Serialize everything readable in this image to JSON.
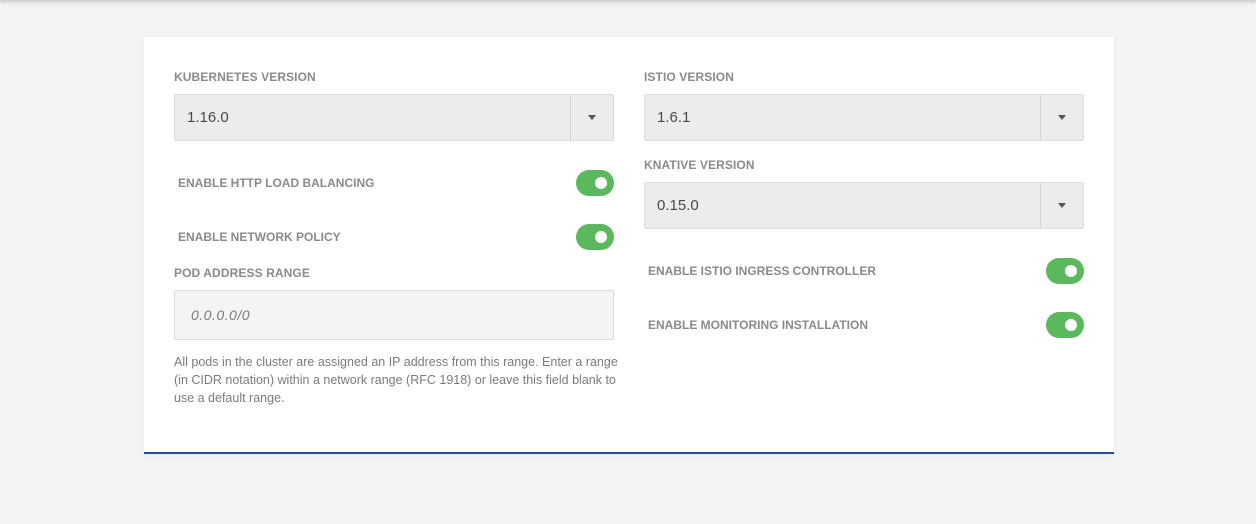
{
  "left": {
    "kubernetes_version": {
      "label": "KUBERNETES VERSION",
      "value": "1.16.0"
    },
    "http_load_balancing": {
      "label": "ENABLE HTTP LOAD BALANCING",
      "enabled": true
    },
    "network_policy": {
      "label": "ENABLE NETWORK POLICY",
      "enabled": true
    },
    "pod_address_range": {
      "label": "POD ADDRESS RANGE",
      "placeholder": "0.0.0.0/0",
      "help": "All pods in the cluster are assigned an IP address from this range. Enter a range (in CIDR notation) within a network range (RFC 1918) or leave this field blank to use a default range."
    }
  },
  "right": {
    "istio_version": {
      "label": "ISTIO VERSION",
      "value": "1.6.1"
    },
    "knative_version": {
      "label": "KNATIVE VERSION",
      "value": "0.15.0"
    },
    "istio_ingress": {
      "label": "ENABLE ISTIO INGRESS CONTROLLER",
      "enabled": true
    },
    "monitoring": {
      "label": "ENABLE MONITORING INSTALLATION",
      "enabled": true
    }
  },
  "colors": {
    "toggle_on": "#5cb85c",
    "card_accent": "#1e4f9c",
    "background": "#f3f3f3"
  },
  "icons": {
    "select_caret": "caret-down-icon"
  }
}
